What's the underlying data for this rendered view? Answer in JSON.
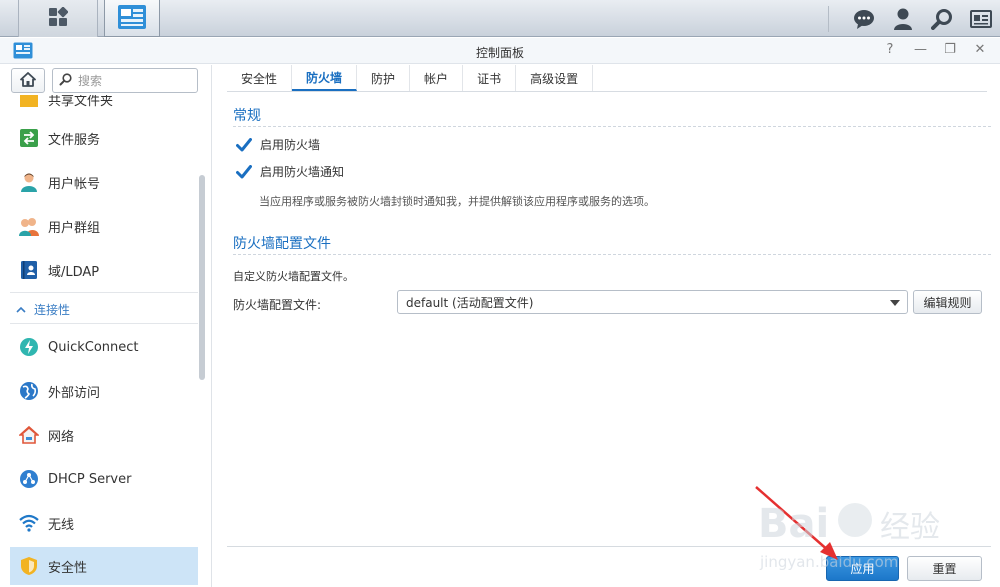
{
  "window": {
    "title": "控制面板"
  },
  "sidebar": {
    "search_placeholder": "搜索",
    "items": [
      {
        "label": "共享文件夹",
        "icon": "shared-folder-icon"
      },
      {
        "label": "文件服务",
        "icon": "file-services-icon"
      },
      {
        "label": "用户帐号",
        "icon": "user-icon"
      },
      {
        "label": "用户群组",
        "icon": "group-icon"
      },
      {
        "label": "域/LDAP",
        "icon": "domain-ldap-icon"
      },
      {
        "label": "QuickConnect",
        "icon": "quickconnect-icon"
      },
      {
        "label": "外部访问",
        "icon": "external-access-icon"
      },
      {
        "label": "网络",
        "icon": "network-icon"
      },
      {
        "label": "DHCP Server",
        "icon": "dhcp-icon"
      },
      {
        "label": "无线",
        "icon": "wireless-icon"
      },
      {
        "label": "安全性",
        "icon": "security-shield-icon"
      }
    ],
    "section_connectivity": "连接性"
  },
  "tabs": [
    "安全性",
    "防火墙",
    "防护",
    "帐户",
    "证书",
    "高级设置"
  ],
  "active_tab": "防火墙",
  "general": {
    "title": "常规",
    "enable_firewall": {
      "label": "启用防火墙",
      "checked": true
    },
    "enable_notification": {
      "label": "启用防火墙通知",
      "checked": true
    },
    "hint": "当应用程序或服务被防火墙封锁时通知我，并提供解锁该应用程序或服务的选项。"
  },
  "profile": {
    "title": "防火墙配置文件",
    "description": "自定义防火墙配置文件。",
    "field_label": "防火墙配置文件:",
    "selected": "default (活动配置文件)",
    "edit_rules": "编辑规则"
  },
  "footer": {
    "apply": "应用",
    "reset": "重置"
  },
  "colors": {
    "accent": "#1a6fc1",
    "primary_button": "#1c77c9",
    "active_item_bg": "#cde4f7",
    "annotation_arrow": "#e53030"
  }
}
